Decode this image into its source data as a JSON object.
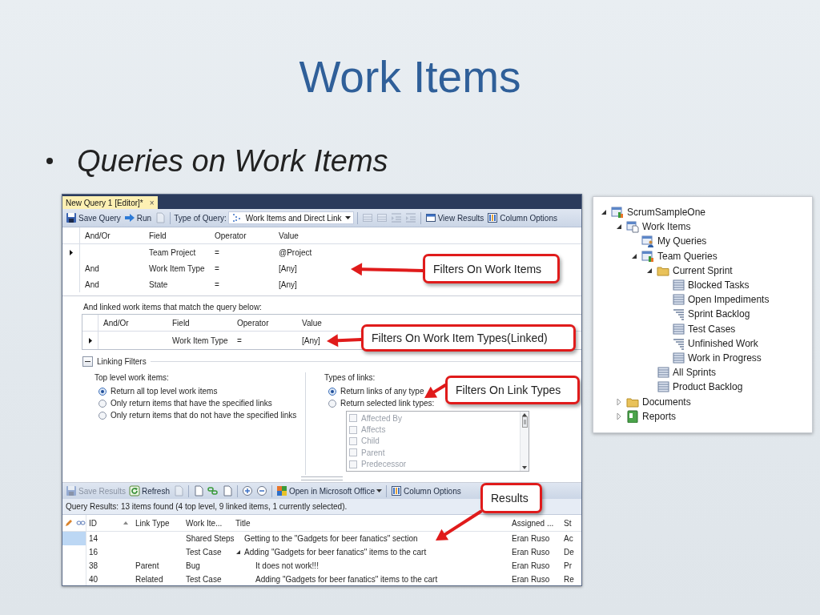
{
  "slide": {
    "title": "Work Items",
    "bullets": [
      "Queries on Work Items"
    ]
  },
  "editor": {
    "tab": {
      "label": "New Query 1 [Editor]*",
      "close": "×"
    },
    "toolbar": [
      {
        "kind": "button",
        "label": "Save Query",
        "disabled": false
      },
      {
        "kind": "button",
        "label": "Run",
        "disabled": false
      },
      {
        "kind": "button",
        "disabled": true
      },
      {
        "kind": "separator"
      },
      {
        "kind": "label",
        "label": "Type of Query:"
      },
      {
        "kind": "dropdown",
        "label": "Work Items and Direct Link"
      },
      {
        "kind": "separator"
      },
      {
        "kind": "button",
        "disabled": true
      },
      {
        "kind": "button",
        "disabled": true
      },
      {
        "kind": "button",
        "disabled": true
      },
      {
        "kind": "button",
        "disabled": true
      },
      {
        "kind": "separator"
      },
      {
        "kind": "button",
        "label": "View Results",
        "disabled": false
      },
      {
        "kind": "button",
        "label": "Column Options",
        "disabled": false
      }
    ],
    "clauses": {
      "columns": [
        "And/Or",
        "Field",
        "Operator",
        "Value"
      ],
      "rows": [
        {
          "field": "Team Project",
          "operator": "=",
          "value": "@Project",
          "current": true
        },
        {
          "and_or": "And",
          "field": "Work Item Type",
          "operator": "=",
          "value": "[Any]",
          "current": false
        },
        {
          "and_or": "And",
          "field": "State",
          "operator": "=",
          "value": "[Any]",
          "current": false
        }
      ]
    },
    "linked_caption": "And linked work items that match the query below:",
    "linked_clauses": {
      "columns": [
        "And/Or",
        "Field",
        "Operator",
        "Value"
      ],
      "rows": [
        {
          "field": "Work Item Type",
          "operator": "=",
          "value": "[Any]",
          "current": true
        }
      ]
    },
    "linking_filters": {
      "label": "Linking Filters",
      "expanded": true,
      "top_level": {
        "label": "Top level work items:",
        "options": [
          {
            "label": "Return all top level work items",
            "selected": true
          },
          {
            "label": "Only return items that have the specified links",
            "selected": false
          },
          {
            "label": "Only return items that do not have the specified links",
            "selected": false
          }
        ]
      },
      "link_types": {
        "label": "Types of links:",
        "options": [
          {
            "label": "Return links of any type",
            "selected": true
          },
          {
            "label": "Return selected link types:",
            "selected": false
          }
        ],
        "types": [
          {
            "label": "Affected By",
            "checked": false,
            "disabled": true
          },
          {
            "label": "Affects",
            "checked": false,
            "disabled": true
          },
          {
            "label": "Child",
            "checked": false,
            "disabled": true
          },
          {
            "label": "Parent",
            "checked": false,
            "disabled": true
          },
          {
            "label": "Predecessor",
            "checked": false,
            "disabled": true
          }
        ]
      }
    },
    "results_toolbar": [
      {
        "kind": "button",
        "label": "Save Results",
        "disabled": true
      },
      {
        "kind": "button",
        "label": "Refresh",
        "disabled": false
      },
      {
        "kind": "button",
        "disabled": true
      },
      {
        "kind": "separator"
      },
      {
        "kind": "button",
        "disabled": false
      },
      {
        "kind": "button",
        "disabled": false
      },
      {
        "kind": "button",
        "disabled": false
      },
      {
        "kind": "separator"
      },
      {
        "kind": "button",
        "disabled": false
      },
      {
        "kind": "button",
        "disabled": false
      },
      {
        "kind": "separator"
      },
      {
        "kind": "menu-button",
        "label": "Open in Microsoft Office"
      },
      {
        "kind": "separator"
      },
      {
        "kind": "button",
        "label": "Column Options",
        "disabled": false
      }
    ],
    "results_summary": "Query Results: 13 items found (4 top level, 9 linked items, 1 currently selected).",
    "results": {
      "columns": [
        {
          "label": "ID",
          "sorted": true
        },
        {
          "label": "Link Type",
          "sorted": false
        },
        {
          "label": "Work Ite...",
          "sorted": false
        },
        {
          "label": "Title",
          "sorted": false
        },
        {
          "label": "Assigned ...",
          "sorted": false
        },
        {
          "label": "St",
          "sorted": false
        }
      ],
      "rows": [
        {
          "id": "14",
          "work_item_type": "Shared Steps",
          "title": "Getting to the \"Gadgets for beer fanatics\" section",
          "assigned_to": "Eran Ruso",
          "column_6": "Ac",
          "selected": true
        },
        {
          "id": "16",
          "work_item_type": "Test Case",
          "title": "Adding \"Gadgets for beer fanatics\" items to the cart",
          "assigned_to": "Eran Ruso",
          "column_6": "De",
          "selected": false,
          "expanded": true,
          "children": [
            {
              "id": "38",
              "link_type": "Parent",
              "work_item_type": "Bug",
              "title": "It does not work!!!",
              "assigned_to": "Eran Ruso",
              "column_6": "Pr",
              "selected": false
            },
            {
              "id": "40",
              "link_type": "Related",
              "work_item_type": "Test Case",
              "title": "Adding \"Gadgets for beer fanatics\" items to the cart",
              "assigned_to": "Eran Ruso",
              "column_6": "Re",
              "selected": false
            }
          ]
        }
      ]
    }
  },
  "callouts": [
    {
      "text": "Filters On Work Items"
    },
    {
      "text": "Filters On Work Item Types(Linked)"
    },
    {
      "text": "Filters On Link Types"
    },
    {
      "text": "Results"
    }
  ],
  "explorer": {
    "nodes": [
      {
        "label": "ScrumSampleOne",
        "kind": "project",
        "expanded": true,
        "children": [
          {
            "label": "Work Items",
            "kind": "work-items",
            "expanded": true,
            "children": [
              {
                "label": "My Queries",
                "kind": "my-queries"
              },
              {
                "label": "Team Queries",
                "kind": "team-queries",
                "expanded": true,
                "children": [
                  {
                    "label": "Current Sprint",
                    "kind": "folder",
                    "expanded": true,
                    "children": [
                      {
                        "label": "Blocked Tasks",
                        "kind": "query"
                      },
                      {
                        "label": "Open Impediments",
                        "kind": "query"
                      },
                      {
                        "label": "Sprint Backlog",
                        "kind": "tree-query"
                      },
                      {
                        "label": "Test Cases",
                        "kind": "query"
                      },
                      {
                        "label": "Unfinished Work",
                        "kind": "tree-query"
                      },
                      {
                        "label": "Work in Progress",
                        "kind": "query"
                      }
                    ]
                  },
                  {
                    "label": "All Sprints",
                    "kind": "query"
                  },
                  {
                    "label": "Product Backlog",
                    "kind": "query"
                  }
                ]
              }
            ]
          },
          {
            "label": "Documents",
            "kind": "folder",
            "expanded": false
          },
          {
            "label": "Reports",
            "kind": "reports",
            "expanded": false
          }
        ]
      }
    ]
  }
}
